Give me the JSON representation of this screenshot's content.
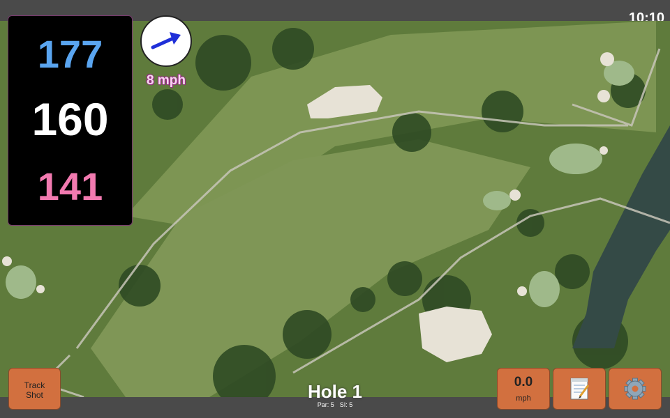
{
  "status": {
    "clock": "10:10"
  },
  "yardages": {
    "back": "177",
    "center": "160",
    "front": "141"
  },
  "wind": {
    "speed": "8 mph",
    "icon": "wind-arrow-icon"
  },
  "hole": {
    "title": "Hole 1",
    "par": "Par: 5",
    "si": "SI: 5"
  },
  "buttons": {
    "track_shot": "Track\nShot",
    "track_line1": "Track",
    "track_line2": "Shot",
    "speed_value": "0.0",
    "speed_unit": "mph",
    "notes_icon": "notepad-icon",
    "settings_icon": "gear-icon"
  },
  "colors": {
    "back": "#5aa5f0",
    "center": "#ffffff",
    "front": "#f27ab0",
    "button": "#d2703f"
  }
}
